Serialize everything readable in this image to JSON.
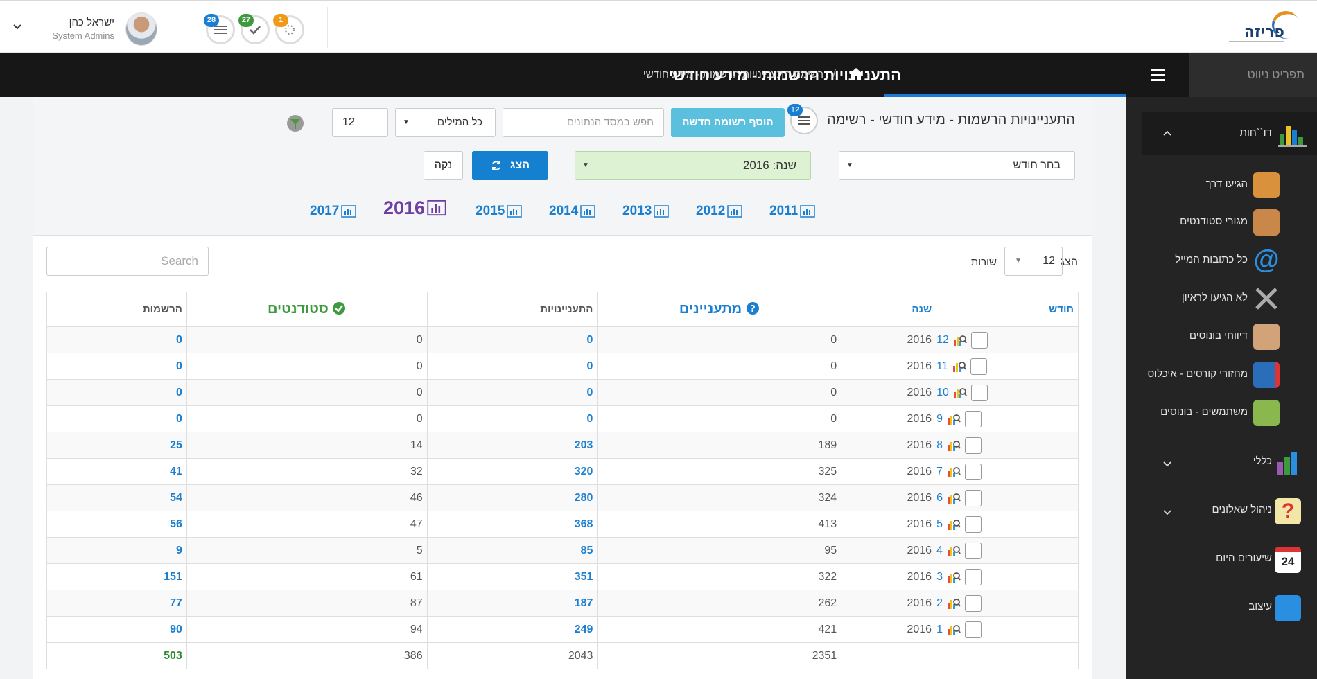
{
  "header": {
    "logo_text": "פריזה",
    "user_name": "ישראל כהן",
    "user_role": "System Admins",
    "notifications": [
      {
        "count": "28",
        "icon": "list-icon",
        "color": "#1b7fd1"
      },
      {
        "count": "27",
        "icon": "check-icon",
        "color": "#3d9a3d"
      },
      {
        "count": "1",
        "icon": "spinner-icon",
        "color": "#ef9a18"
      }
    ]
  },
  "titlebar": {
    "page_title": "התעניינויות הרשמות - מידע חודשי",
    "breadcrumb_sep": "/",
    "breadcrumb": "רשימת התעניינויות הרשמות - מידע חודשי"
  },
  "sidebar": {
    "header_label": "תפריט ניווט",
    "group_reports": "דו``חות",
    "sub_items": [
      {
        "label": "הגיעו דרך",
        "icon": "door-icon"
      },
      {
        "label": "מגורי סטודנטים",
        "icon": "house-icon"
      },
      {
        "label": "כל כתובות המייל",
        "icon": "at-icon"
      },
      {
        "label": "לא הגיעו לראיון",
        "icon": "x-icon"
      },
      {
        "label": "דיווחי בונוסים",
        "icon": "handshake-icon"
      },
      {
        "label": "מחזורי קורסים - איכלוס",
        "icon": "book-icon"
      },
      {
        "label": "משתמשים - בונוסים",
        "icon": "users-icon"
      }
    ],
    "items": [
      {
        "label": "כללי",
        "icon": "chart-icon"
      },
      {
        "label": "ניהול שאלונים",
        "icon": "question-icon"
      },
      {
        "label": "שיעורים היום",
        "icon": "calendar-icon"
      },
      {
        "label": "עיצוב",
        "icon": "presenter-icon"
      }
    ],
    "calendar_day": "24"
  },
  "filters": {
    "list_title": "התעניינויות הרשמות - מידע חודשי - רשימה",
    "list_badge": "12",
    "add_button": "הוסף רשומה חדשה",
    "search_placeholder": "חפש במסד הנתונים",
    "words_select": "כל המילים",
    "rows_value": "12",
    "month_select": "בחר חודש",
    "year_select": "שנה: 2016",
    "show_button": "הצג",
    "clear_button": "נקה",
    "year_tabs": [
      "2011",
      "2012",
      "2013",
      "2014",
      "2015",
      "2016",
      "2017"
    ],
    "active_year": "2016"
  },
  "table_controls": {
    "show_label": "הצג",
    "length_value": "12",
    "rows_label": "שורות",
    "search_placeholder": "Search"
  },
  "table": {
    "headers": {
      "month": "חודש",
      "year": "שנה",
      "interested": "מתעניינים",
      "inquiries": "התעניינויות",
      "students": "סטודנטים",
      "registrations": "הרשמות"
    },
    "rows": [
      {
        "month": "12",
        "year": "2016",
        "interested": "0",
        "inquiries": "0",
        "students": "0",
        "registrations": "0"
      },
      {
        "month": "11",
        "year": "2016",
        "interested": "0",
        "inquiries": "0",
        "students": "0",
        "registrations": "0"
      },
      {
        "month": "10",
        "year": "2016",
        "interested": "0",
        "inquiries": "0",
        "students": "0",
        "registrations": "0"
      },
      {
        "month": "9",
        "year": "2016",
        "interested": "0",
        "inquiries": "0",
        "students": "0",
        "registrations": "0"
      },
      {
        "month": "8",
        "year": "2016",
        "interested": "189",
        "inquiries": "203",
        "students": "14",
        "registrations": "25"
      },
      {
        "month": "7",
        "year": "2016",
        "interested": "325",
        "inquiries": "320",
        "students": "32",
        "registrations": "41"
      },
      {
        "month": "6",
        "year": "2016",
        "interested": "324",
        "inquiries": "280",
        "students": "46",
        "registrations": "54"
      },
      {
        "month": "5",
        "year": "2016",
        "interested": "413",
        "inquiries": "368",
        "students": "47",
        "registrations": "56"
      },
      {
        "month": "4",
        "year": "2016",
        "interested": "95",
        "inquiries": "85",
        "students": "5",
        "registrations": "9"
      },
      {
        "month": "3",
        "year": "2016",
        "interested": "322",
        "inquiries": "351",
        "students": "61",
        "registrations": "151"
      },
      {
        "month": "2",
        "year": "2016",
        "interested": "262",
        "inquiries": "187",
        "students": "87",
        "registrations": "77"
      },
      {
        "month": "1",
        "year": "2016",
        "interested": "421",
        "inquiries": "249",
        "students": "94",
        "registrations": "90"
      }
    ],
    "totals": {
      "interested": "2351",
      "inquiries": "2043",
      "students": "386",
      "registrations": "503"
    }
  }
}
